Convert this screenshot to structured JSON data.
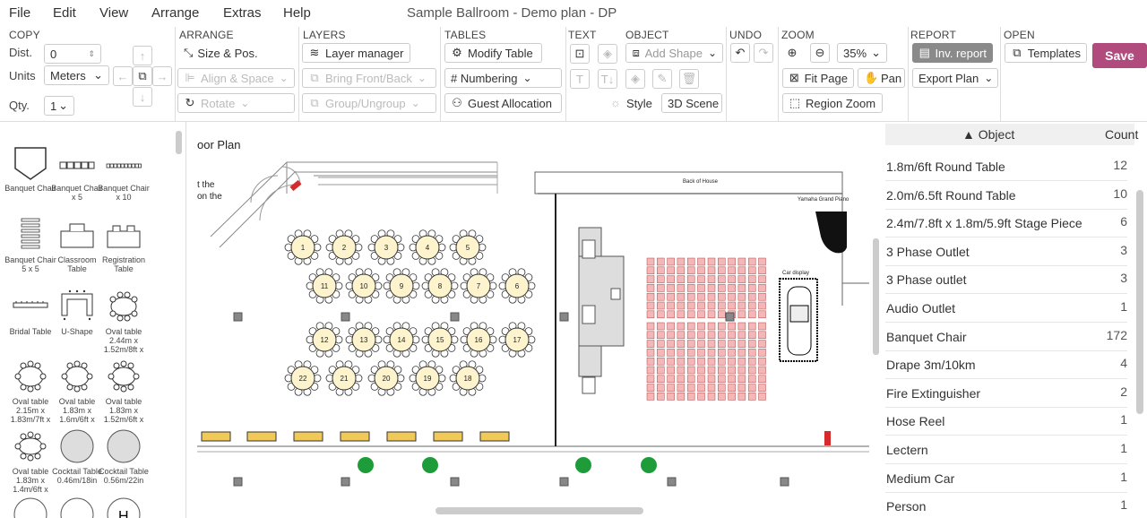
{
  "menu": {
    "items": [
      "File",
      "Edit",
      "View",
      "Arrange",
      "Extras",
      "Help"
    ],
    "doc_title": "Sample Ballroom - Demo plan - DP"
  },
  "toolbar": {
    "copy": {
      "title": "COPY",
      "dist_label": "Dist.",
      "dist_value": "0",
      "units_label": "Units",
      "units_value": "Meters",
      "qty_label": "Qty.",
      "qty_value": "1"
    },
    "arrange": {
      "title": "ARRANGE",
      "size_pos": "Size & Pos.",
      "align_space": "Align & Space",
      "rotate": "Rotate"
    },
    "layers": {
      "title": "LAYERS",
      "manager": "Layer manager",
      "bring_front_back": "Bring Front/Back",
      "group_ungroup": "Group/Ungroup"
    },
    "tables": {
      "title": "TABLES",
      "modify": "Modify Table",
      "numbering": "# Numbering",
      "guest_allocation": "Guest Allocation"
    },
    "text": {
      "title": "TEXT"
    },
    "object": {
      "title": "OBJECT",
      "add_shape": "Add Shape",
      "style": "Style",
      "scene3d": "3D Scene"
    },
    "undo": {
      "title": "UNDO"
    },
    "zoom": {
      "title": "ZOOM",
      "level": "35%",
      "fit_page": "Fit Page",
      "pan": "Pan",
      "region_zoom": "Region Zoom"
    },
    "report": {
      "title": "REPORT",
      "inv_report": "Inv. report",
      "export_plan": "Export Plan"
    },
    "open": {
      "title": "OPEN",
      "templates": "Templates"
    },
    "save": "Save"
  },
  "palette": {
    "items": [
      {
        "label": "Banquet Chair",
        "icon": "banquet-chair-icon"
      },
      {
        "label": "Banquet Chair x 5",
        "icon": "chair-row-5-icon"
      },
      {
        "label": "Banquet Chair x 10",
        "icon": "chair-row-10-icon"
      },
      {
        "label": "Banquet Chair 5 x 5",
        "icon": "chair-grid-icon"
      },
      {
        "label": "Classroom Table",
        "icon": "classroom-table-icon"
      },
      {
        "label": "Registration Table",
        "icon": "registration-table-icon"
      },
      {
        "label": "Bridal Table",
        "icon": "bridal-table-icon"
      },
      {
        "label": "U-Shape",
        "icon": "u-shape-icon"
      },
      {
        "label": "Oval table 2.44m x 1.52m/8ft x",
        "icon": "oval-table-icon"
      },
      {
        "label": "Oval table 2.15m x 1.83m/7ft x",
        "icon": "oval-table-icon"
      },
      {
        "label": "Oval table 1.83m x 1.6m/6ft x",
        "icon": "oval-table-icon"
      },
      {
        "label": "Oval table 1.83m x 1.52m/6ft x",
        "icon": "oval-table-icon"
      },
      {
        "label": "Oval table 1.83m x 1.4m/6ft x",
        "icon": "oval-table-icon"
      },
      {
        "label": "Cocktail Table 0.46m/18in",
        "icon": "cocktail-table-icon"
      },
      {
        "label": "Cocktail Table 0.56m/22in",
        "icon": "cocktail-table-icon"
      }
    ]
  },
  "canvas": {
    "plan_title_fragment": "oor Plan",
    "note_fragment_1": "t the",
    "note_fragment_2": "on the",
    "back_of_house": "Back of House",
    "piano_label": "Yamaha Grand Piano",
    "car_label": "Car display",
    "tables_row1": [
      "1",
      "2",
      "3",
      "4",
      "5"
    ],
    "tables_row2": [
      "11",
      "10",
      "9",
      "8",
      "7",
      "6"
    ],
    "tables_row3": [
      "12",
      "13",
      "14",
      "15",
      "16",
      "17"
    ],
    "tables_row4": [
      "22",
      "21",
      "20",
      "19",
      "18"
    ]
  },
  "report": {
    "col_object": "Object",
    "col_count": "Count",
    "rows": [
      {
        "name": "1.8m/6ft Round Table",
        "count": "12"
      },
      {
        "name": "2.0m/6.5ft Round Table",
        "count": "10"
      },
      {
        "name": "2.4m/7.8ft x 1.8m/5.9ft Stage Piece",
        "count": "6"
      },
      {
        "name": "3 Phase Outlet",
        "count": "3"
      },
      {
        "name": "3 Phase outlet",
        "count": "3"
      },
      {
        "name": "Audio Outlet",
        "count": "1"
      },
      {
        "name": "Banquet Chair",
        "count": "172"
      },
      {
        "name": "Drape 3m/10km",
        "count": "4"
      },
      {
        "name": "Fire Extinguisher",
        "count": "2"
      },
      {
        "name": "Hose Reel",
        "count": "1"
      },
      {
        "name": "Lectern",
        "count": "1"
      },
      {
        "name": "Medium Car",
        "count": "1"
      },
      {
        "name": "Person",
        "count": "1"
      }
    ]
  },
  "colors": {
    "accent": "#b14a7d",
    "table_fill": "#fdf3cc",
    "chair_fill": "#f4b6b6"
  }
}
